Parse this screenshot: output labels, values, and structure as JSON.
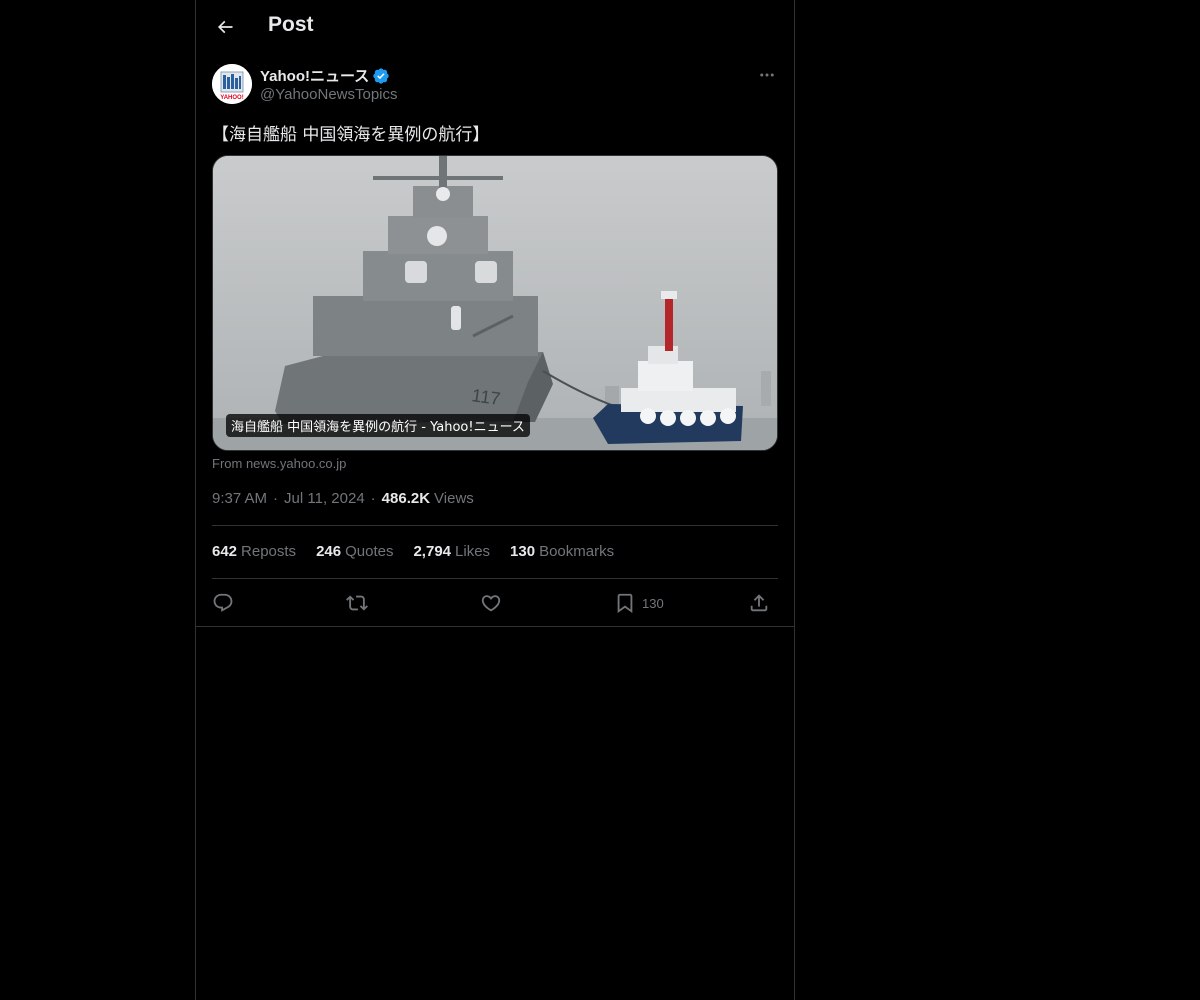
{
  "header": {
    "title": "Post"
  },
  "author": {
    "name": "Yahoo!ニュース",
    "handle": "@YahooNewsTopics",
    "avatar_text": "YAHOO!"
  },
  "post": {
    "text": "【海自艦船 中国領海を異例の航行】",
    "card": {
      "caption": "海自艦船 中国領海を異例の航行 - Yahoo!ニュース",
      "source": "From news.yahoo.co.jp",
      "hull_number": "117"
    },
    "time": "9:37 AM",
    "date": "Jul 11, 2024",
    "separator": "·",
    "views_count": "486.2K",
    "views_label": "Views"
  },
  "stats": [
    {
      "num": "642",
      "label": "Reposts"
    },
    {
      "num": "246",
      "label": "Quotes"
    },
    {
      "num": "2,794",
      "label": "Likes"
    },
    {
      "num": "130",
      "label": "Bookmarks"
    }
  ],
  "actions": {
    "bookmark_count": "130"
  },
  "colors": {
    "background": "#000000",
    "text_primary": "#e7e9ea",
    "text_secondary": "#71767b",
    "border": "#2f3336",
    "verified": "#1d9bf0"
  }
}
